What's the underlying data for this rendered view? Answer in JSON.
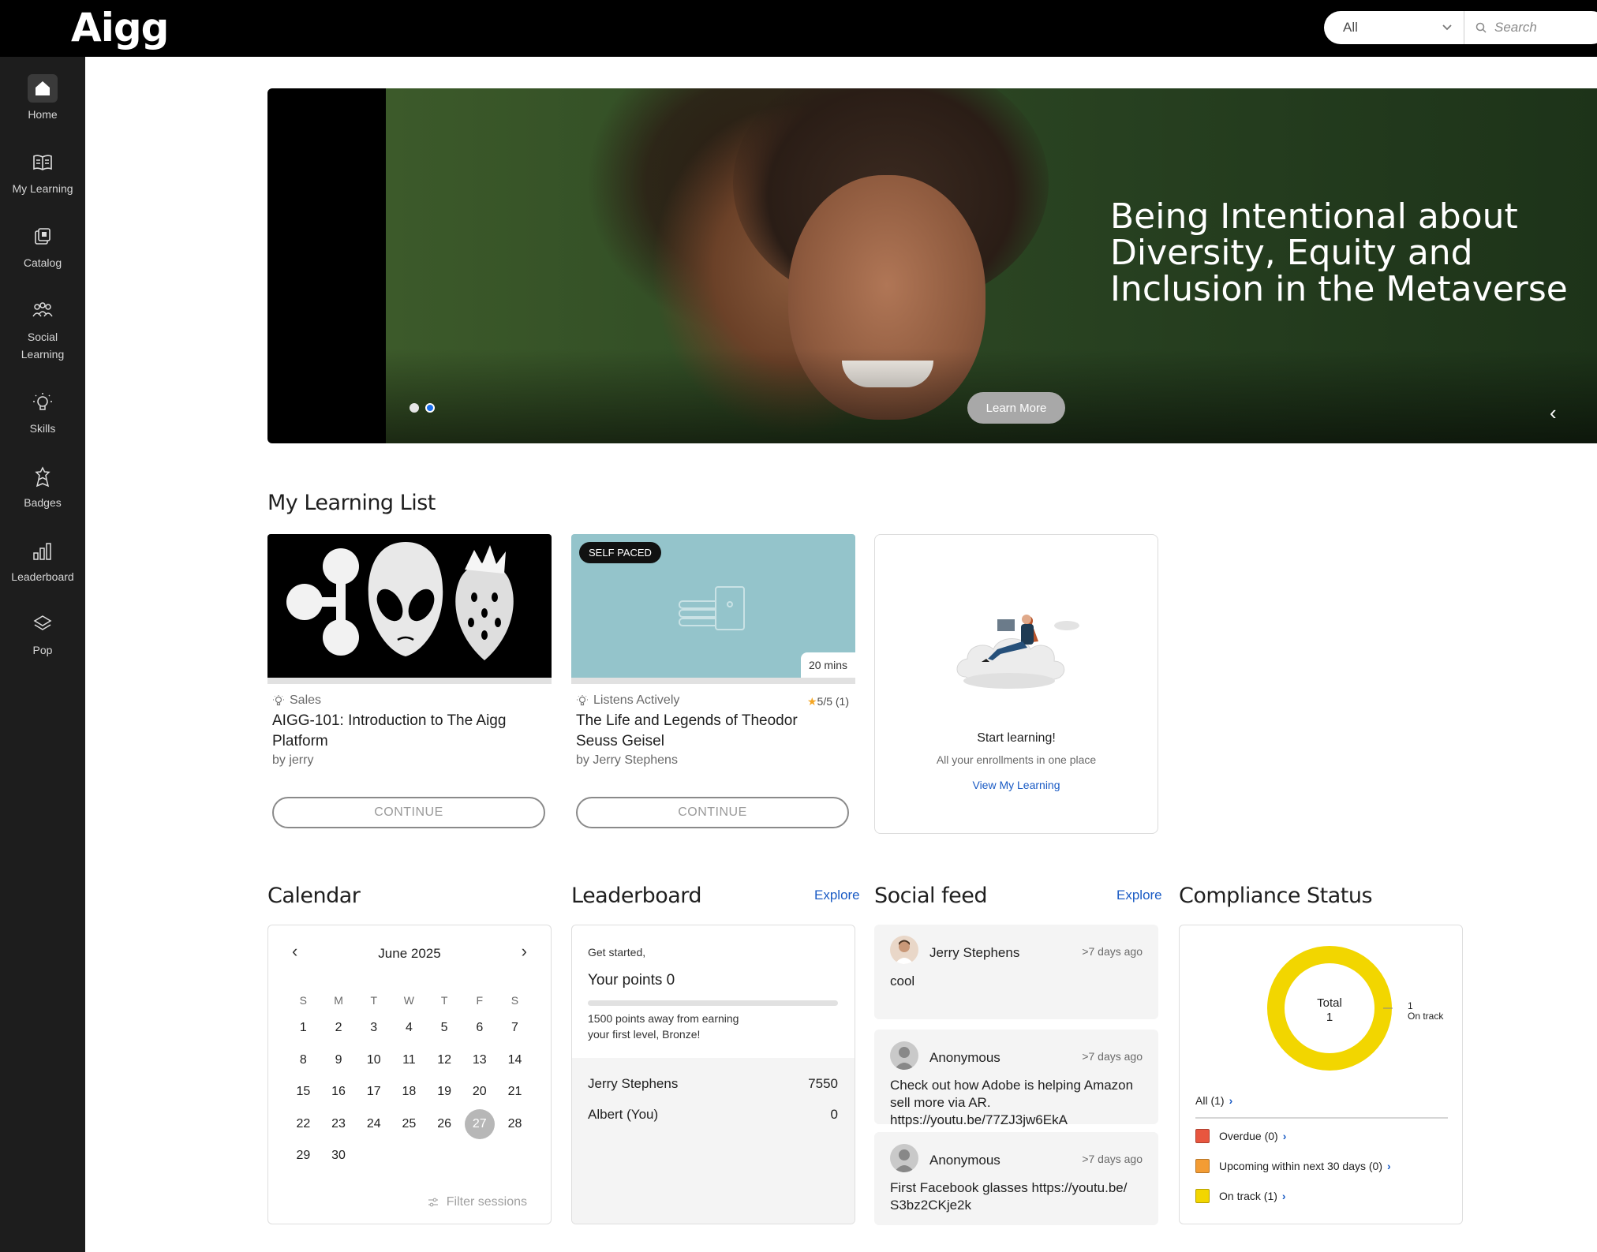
{
  "app": {
    "logo": "Aigg"
  },
  "search": {
    "scope": "All",
    "placeholder": "Search"
  },
  "sidebar": {
    "items": [
      {
        "label": "Home",
        "icon": "home-icon"
      },
      {
        "label": "My Learning",
        "icon": "book-icon"
      },
      {
        "label": "Catalog",
        "icon": "catalog-icon"
      },
      {
        "label": "Social Learning",
        "icon": "people-icon"
      },
      {
        "label": "Skills",
        "icon": "lightbulb-icon"
      },
      {
        "label": "Badges",
        "icon": "badge-icon"
      },
      {
        "label": "Leaderboard",
        "icon": "bar-chart-icon"
      },
      {
        "label": "Pop",
        "icon": "layers-icon"
      }
    ]
  },
  "hero": {
    "title": "Being Intentional about Diversity, Equity and Inclusion in the Metaverse",
    "button": "Learn More",
    "slides": 2,
    "active_slide": 2
  },
  "learning_list": {
    "title": "My Learning List",
    "cards": [
      {
        "skill": "Sales",
        "title": "AIGG-101: Introduction to The Aigg Platform",
        "author": "by jerry",
        "button": "CONTINUE",
        "progress": 0
      },
      {
        "badge": "SELF PACED",
        "duration": "20 mins",
        "skill": "Listens Actively",
        "rating": "5/5 (1)",
        "title": "The Life and Legends of Theodor Seuss Geisel",
        "author": "by Jerry Stephens",
        "button": "CONTINUE",
        "progress": 0
      }
    ],
    "start": {
      "title": "Start learning!",
      "subtitle": "All your enrollments in one place",
      "link": "View My Learning"
    }
  },
  "calendar": {
    "title": "Calendar",
    "month": "June 2025",
    "weekdays": [
      "S",
      "M",
      "T",
      "W",
      "T",
      "F",
      "S"
    ],
    "days": [
      "1",
      "2",
      "3",
      "4",
      "5",
      "6",
      "7",
      "8",
      "9",
      "10",
      "11",
      "12",
      "13",
      "14",
      "15",
      "16",
      "17",
      "18",
      "19",
      "20",
      "21",
      "22",
      "23",
      "24",
      "25",
      "26",
      "27",
      "28",
      "29",
      "30"
    ],
    "first_weekday_index": 0,
    "today": "27",
    "filter": "Filter sessions"
  },
  "leaderboard": {
    "title": "Leaderboard",
    "explore": "Explore",
    "greeting": "Get started,",
    "points": "Your points 0",
    "progress": 0,
    "away": "1500 points away from earning your first level, Bronze!",
    "rows": [
      {
        "name": "Jerry Stephens",
        "score": "7550"
      },
      {
        "name": "Albert (You)",
        "score": "0"
      }
    ]
  },
  "social_feed": {
    "title": "Social feed",
    "explore": "Explore",
    "posts": [
      {
        "author": "Jerry Stephens",
        "time": ">7 days ago",
        "text": "cool"
      },
      {
        "author": "Anonymous",
        "time": ">7 days ago",
        "text": "Check out how Adobe is helping Amazon sell more via AR.   https://youtu.be/77ZJ3jw6EkA"
      },
      {
        "author": "Anonymous",
        "time": ">7 days ago",
        "text": "First Facebook glasses https://youtu.be/ S3bz2CKje2k"
      }
    ]
  },
  "compliance": {
    "title": "Compliance Status",
    "total_label": "Total",
    "total_value": "1",
    "on_track_count": "1",
    "on_track_label": "On track",
    "all": "All (1)",
    "rows": [
      {
        "label": "Overdue (0)",
        "color": "#e8563f"
      },
      {
        "label": "Upcoming within next 30 days (0)",
        "color": "#f39c34"
      },
      {
        "label": "On track (1)",
        "color": "#f2d600"
      }
    ],
    "chart_color": "#f2d600"
  }
}
